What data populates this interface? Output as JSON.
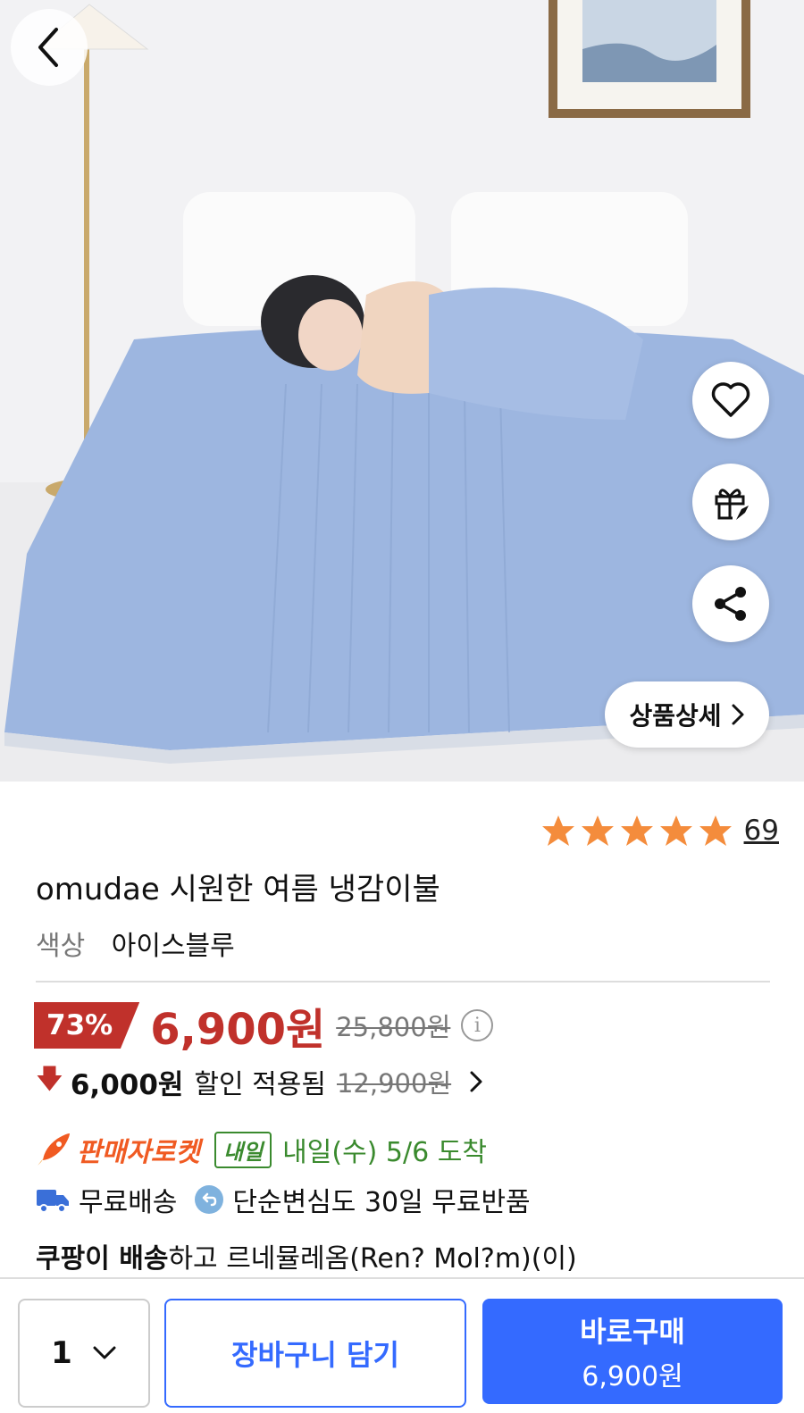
{
  "hero": {
    "image": "product-photo-blue-blanket-bedroom",
    "detail_label": "상품상세"
  },
  "icons": {
    "back": "back-arrow-icon",
    "wishlist": "heart-icon",
    "gift": "gift-icon",
    "share": "share-icon"
  },
  "rating": {
    "stars": 5,
    "review_count": "69"
  },
  "product": {
    "title": "omudae 시원한 여름 냉감이불",
    "option_label": "색상",
    "option_value": "아이스블루"
  },
  "price": {
    "discount_rate": "73%",
    "sale_price": "6,900원",
    "original_price": "25,800원",
    "coupon_amount": "6,000원",
    "coupon_text": "할인 적용됨",
    "coupon_original": "12,900원"
  },
  "delivery": {
    "rocket_label": "판매자로켓",
    "tomorrow_badge": "내일",
    "arrival_text": "내일(수) 5/6 도착",
    "free_shipping": "무료배송",
    "free_return": "단순변심도 30일 무료반품",
    "seller_bold": "쿠팡이 배송",
    "seller_rest": "하고 르네뮬레옴(Ren? Mol?m)(이)"
  },
  "bottom": {
    "quantity": "1",
    "cart_label": "장바구니 담기",
    "buy_label": "바로구매",
    "buy_price": "6,900원"
  },
  "colors": {
    "accent_red": "#c0312b",
    "accent_blue": "#346aff",
    "rocket_orange": "#f05a22",
    "green": "#3a8a2e",
    "star": "#f48c3c"
  }
}
